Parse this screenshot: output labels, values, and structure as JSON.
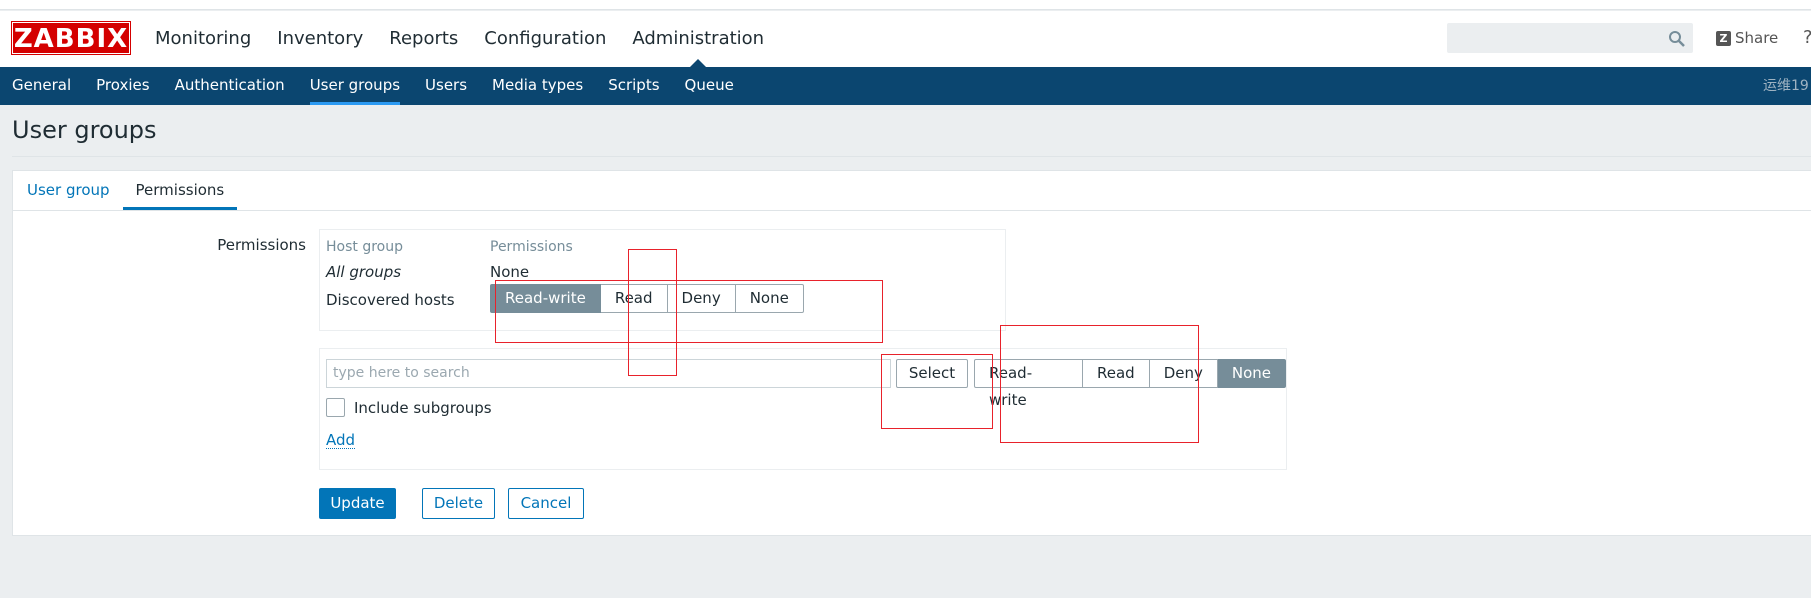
{
  "header": {
    "logo_text": "ZABBIX",
    "nav": [
      "Monitoring",
      "Inventory",
      "Reports",
      "Configuration",
      "Administration"
    ],
    "active_nav": "Administration",
    "search_placeholder": "",
    "share_label": "Share",
    "help_label": "?"
  },
  "subnav": {
    "items": [
      "General",
      "Proxies",
      "Authentication",
      "User groups",
      "Users",
      "Media types",
      "Scripts",
      "Queue"
    ],
    "active": "User groups",
    "user_label": "运维19"
  },
  "page_title": "User groups",
  "tabs": [
    "User group",
    "Permissions"
  ],
  "active_tab": "Permissions",
  "permissions": {
    "field_label": "Permissions",
    "columns": {
      "host_group": "Host group",
      "permissions": "Permissions"
    },
    "rows": [
      {
        "host_group": "All groups",
        "permission": "None"
      },
      {
        "host_group": "Discovered hosts",
        "options": [
          "Read-write",
          "Read",
          "Deny",
          "None"
        ],
        "selected": "Read-write"
      }
    ]
  },
  "add_panel": {
    "search_placeholder": "type here to search",
    "select_label": "Select",
    "options": [
      "Read-write",
      "Read",
      "Deny",
      "None"
    ],
    "selected": "None",
    "include_subgroups_label": "Include subgroups",
    "add_label": "Add"
  },
  "buttons": {
    "update": "Update",
    "delete": "Delete",
    "cancel": "Cancel"
  },
  "colors": {
    "nav_bar": "#0b4670",
    "primary": "#0275b8",
    "logo": "#d40000",
    "selected_option": "#768d99",
    "annotation": "#e8222b"
  }
}
